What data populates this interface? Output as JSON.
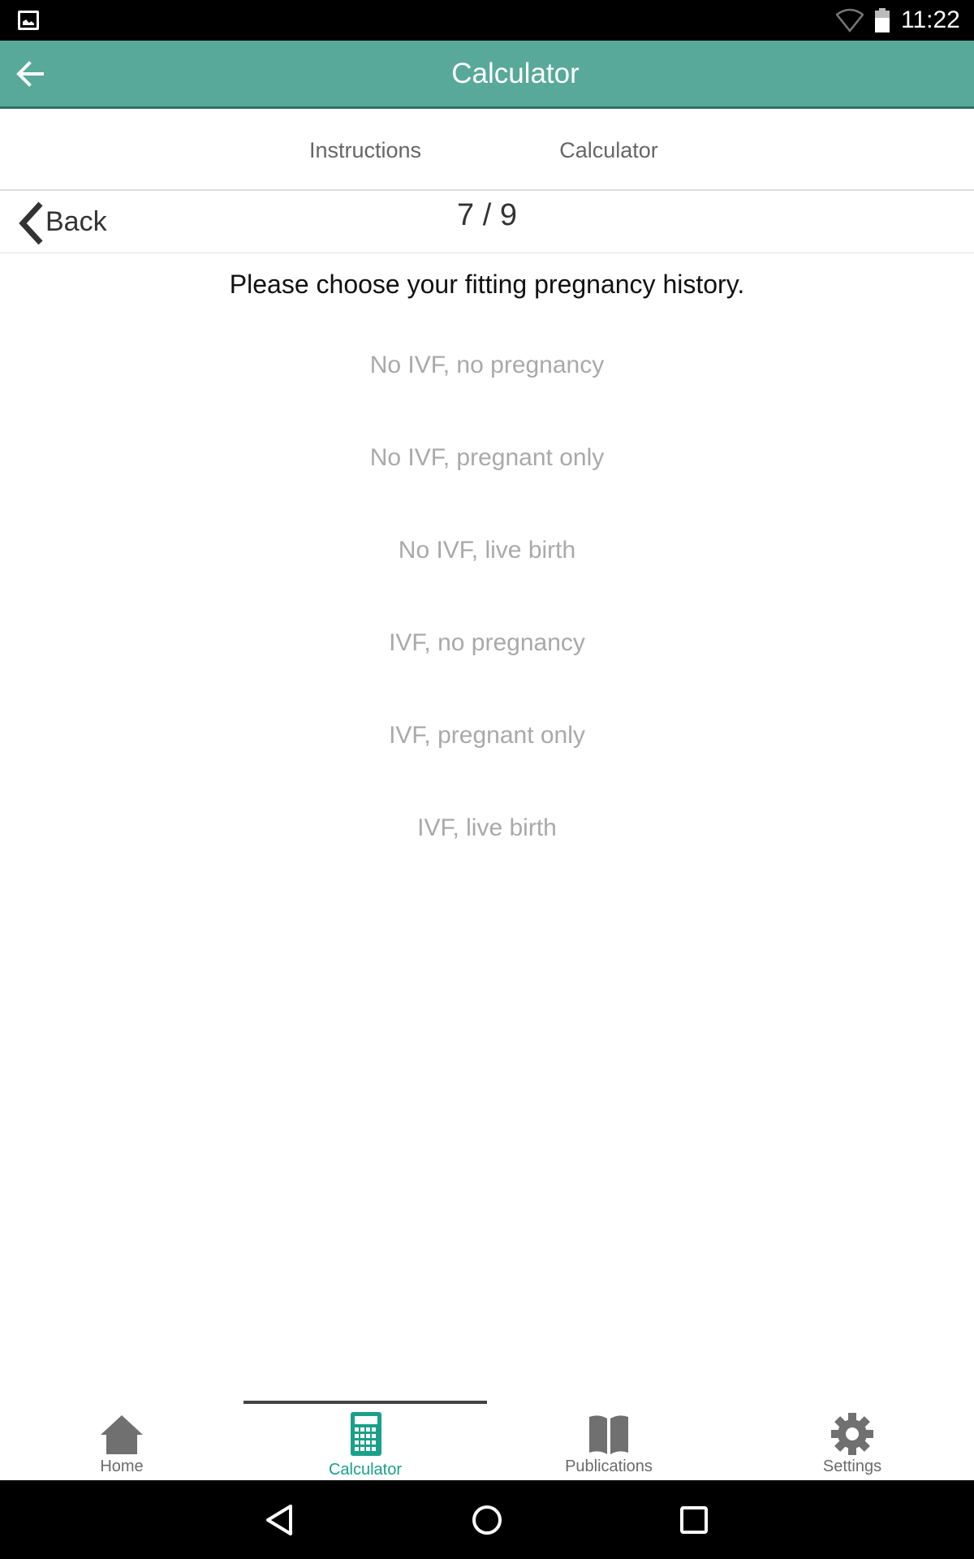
{
  "status_bar": {
    "time": "11:22",
    "icons": [
      "image-notification-icon",
      "wifi-icon",
      "battery-icon"
    ]
  },
  "app_bar": {
    "title": "Calculator",
    "back_icon": "arrow-left-icon",
    "color": "#58a99a"
  },
  "tabs": [
    {
      "label": "Instructions"
    },
    {
      "label": "Calculator"
    }
  ],
  "step": {
    "back_label": "Back",
    "counter": "7 / 9"
  },
  "question": "Please choose your fitting pregnancy history.",
  "options": [
    {
      "label": "No IVF, no pregnancy"
    },
    {
      "label": "No IVF, pregnant only"
    },
    {
      "label": "No IVF, live birth"
    },
    {
      "label": "IVF, no pregnancy"
    },
    {
      "label": "IVF, pregnant only"
    },
    {
      "label": "IVF, live birth"
    }
  ],
  "bottom_nav": {
    "items": [
      {
        "label": "Home",
        "icon": "home-icon",
        "active": false
      },
      {
        "label": "Calculator",
        "icon": "calculator-icon",
        "active": true
      },
      {
        "label": "Publications",
        "icon": "book-icon",
        "active": false
      },
      {
        "label": "Settings",
        "icon": "gear-icon",
        "active": false
      }
    ],
    "active_color": "#1aa08a"
  },
  "system_nav": {
    "icons": [
      "back-triangle-icon",
      "home-circle-icon",
      "recents-square-icon"
    ]
  }
}
